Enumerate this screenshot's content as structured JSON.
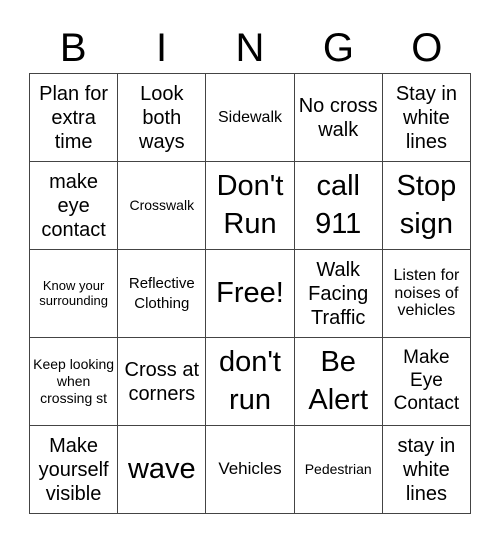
{
  "header": {
    "letters": [
      "B",
      "I",
      "N",
      "G",
      "O"
    ]
  },
  "board": {
    "rows": [
      [
        "Plan for extra time",
        "Look both ways",
        "Sidewalk",
        "No cross walk",
        "Stay in white lines"
      ],
      [
        "make eye contact",
        "Crosswalk",
        "Don't Run",
        "call 911",
        "Stop sign"
      ],
      [
        "Know your surrounding",
        "Reflective Clothing",
        "Free!",
        "Walk Facing Traffic",
        "Listen for noises of vehicles"
      ],
      [
        "Keep looking when crossing st",
        "Cross at corners",
        "don't run",
        "Be Alert",
        "Make Eye Contact"
      ],
      [
        "Make yourself visible",
        "wave",
        "Vehicles",
        "Pedestrian",
        "stay in white lines"
      ]
    ]
  }
}
